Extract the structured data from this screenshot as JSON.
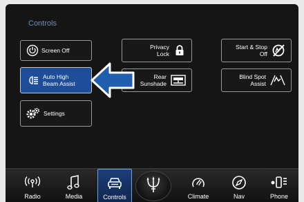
{
  "screen": {
    "title": "Controls"
  },
  "buttons": {
    "screen_off": "Screen Off",
    "auto_high_beam": [
      "Auto High",
      "Beam Assist"
    ],
    "settings": "Settings",
    "privacy_lock": [
      "Privacy",
      "Lock"
    ],
    "rear_sunshade": [
      "Rear",
      "Sunshade"
    ],
    "start_stop": [
      "Start & Stop",
      "Off"
    ],
    "blind_spot": [
      "Blind Spot",
      "Assist"
    ]
  },
  "nav": {
    "radio": "Radio",
    "media": "Media",
    "controls": "Controls",
    "climate": "Climate",
    "nav": "Nav",
    "phone": "Phone"
  },
  "colors": {
    "accent": "#1e4d9a",
    "title": "#6f8fbf",
    "callout_arrow": "#1f5fae"
  }
}
